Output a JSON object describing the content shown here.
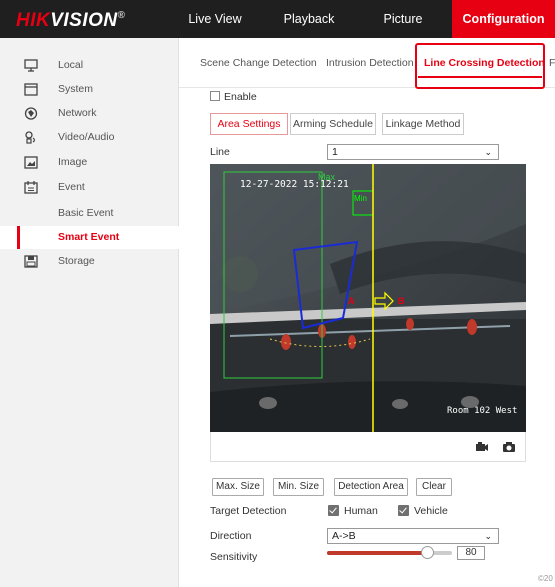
{
  "logo": {
    "brand_red": "HIK",
    "brand_rest": "VISION",
    "mark": "®"
  },
  "nav": {
    "items": [
      {
        "label": "Live View"
      },
      {
        "label": "Playback"
      },
      {
        "label": "Picture"
      },
      {
        "label": "Configuration",
        "active": true
      }
    ]
  },
  "sidebar": {
    "items": [
      {
        "label": "Local",
        "icon": "monitor-icon"
      },
      {
        "label": "System",
        "icon": "system-icon"
      },
      {
        "label": "Network",
        "icon": "network-icon"
      },
      {
        "label": "Video/Audio",
        "icon": "video-audio-icon"
      },
      {
        "label": "Image",
        "icon": "image-icon"
      },
      {
        "label": "Event",
        "icon": "event-icon"
      },
      {
        "label": "Basic Event",
        "sub": true
      },
      {
        "label": "Smart Event",
        "sub": true,
        "active": true
      },
      {
        "label": "Storage",
        "icon": "storage-icon"
      }
    ]
  },
  "tabs": {
    "items": [
      {
        "label": "Scene Change Detection"
      },
      {
        "label": "Intrusion Detection"
      },
      {
        "label": "Line Crossing Detection",
        "active": true
      },
      {
        "label": "F"
      }
    ]
  },
  "enable": {
    "label": "Enable",
    "checked": false
  },
  "subtabs": {
    "items": [
      {
        "label": "Area Settings",
        "active": true
      },
      {
        "label": "Arming Schedule"
      },
      {
        "label": "Linkage Method"
      }
    ]
  },
  "line": {
    "label": "Line",
    "value": "1"
  },
  "video": {
    "timestamp": "12-27-2022 15:12:21",
    "max_label": "Max",
    "min_label": "Min",
    "point_a": "A",
    "point_b": "B",
    "camera_name": "Room 102 West"
  },
  "buttons": {
    "max_size": "Max. Size",
    "min_size": "Min. Size",
    "detection_area": "Detection Area",
    "clear": "Clear"
  },
  "target_detection": {
    "label": "Target Detection",
    "options": [
      {
        "label": "Human",
        "checked": true
      },
      {
        "label": "Vehicle",
        "checked": true
      }
    ]
  },
  "direction": {
    "label": "Direction",
    "value": "A->B"
  },
  "sensitivity": {
    "label": "Sensitivity",
    "value": "80",
    "level": 0.8
  },
  "footer": {
    "copyright": "©20"
  },
  "colors": {
    "accent": "#e60012",
    "max_box": "#2ecc40",
    "min_box": "#00ff00",
    "area": "#1a2bd6",
    "line": "#ffff00"
  }
}
